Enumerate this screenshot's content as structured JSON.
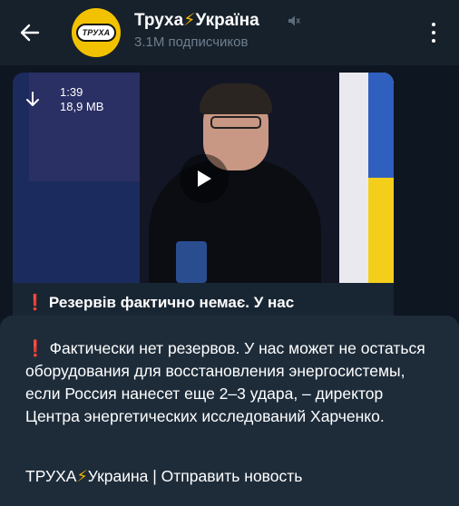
{
  "header": {
    "back_icon": "arrow-left-icon",
    "avatar_text": "ТРУХА",
    "channel_name_prefix": "Труха",
    "channel_name_suffix": "Україна",
    "bolt": "⚡",
    "subscribers": "3.1M подписчиков",
    "mute_icon": "muted-speaker-icon",
    "menu_icon": "more-vertical-icon"
  },
  "post": {
    "video": {
      "duration": "1:39",
      "size": "18,9 MB",
      "download_icon": "download-arrow-icon",
      "play_icon": "play-icon"
    },
    "mark": "❗",
    "text": "Резервів фактично немає. У нас"
  },
  "translation": {
    "mark": "❗",
    "text": "Фактически нет резервов. У нас может не остаться оборудования для восстановления энергосистемы, если Россия нанесет еще 2–3 удара, – директор Центра энергетических исследований Харченко.",
    "footer_prefix": "ТРУХА",
    "bolt": "⚡",
    "footer_suffix": "Украина | Отправить новость"
  },
  "colors": {
    "background": "#0e1621",
    "header": "#17212b",
    "sheet": "#1e2c3a",
    "accent_bolt": "#f5b400",
    "alert_red": "#e53935"
  }
}
